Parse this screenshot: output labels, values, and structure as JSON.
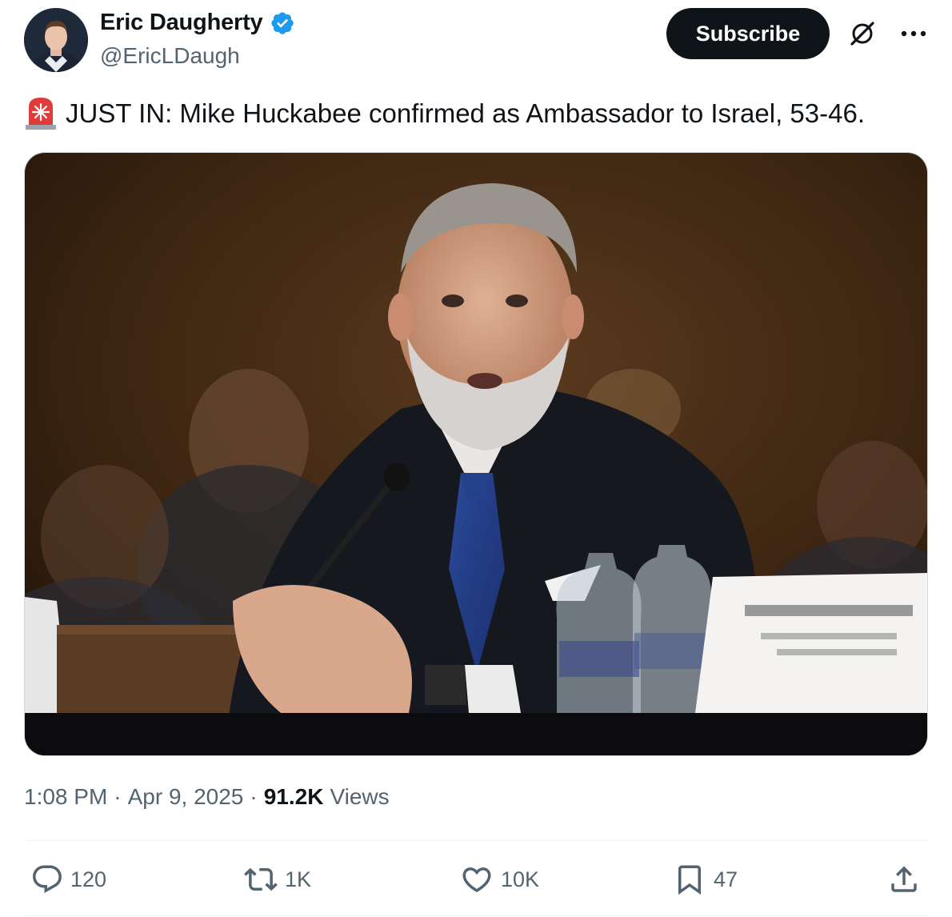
{
  "author": {
    "display_name": "Eric Daugherty",
    "handle": "@EricLDaugh",
    "verified": true
  },
  "header": {
    "subscribe_label": "Subscribe"
  },
  "tweet": {
    "emoji": "rotating-light-emoji",
    "text": "JUST IN: Mike Huckabee confirmed as Ambassador to Israel, 53-46."
  },
  "meta": {
    "time": "1:08 PM",
    "date": "Apr 9, 2025",
    "views_count": "91.2K",
    "views_label": "Views"
  },
  "actions": {
    "replies": "120",
    "reposts": "1K",
    "likes": "10K",
    "bookmarks": "47"
  },
  "colors": {
    "accent": "#1d9bf0",
    "text": "#0f1419",
    "secondary": "#536471",
    "button_bg": "#0f1419"
  }
}
